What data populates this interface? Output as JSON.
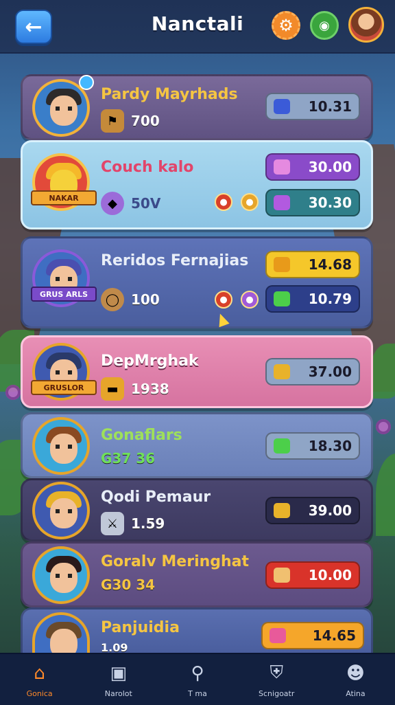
{
  "header": {
    "title": "Nanctali"
  },
  "cards": [
    {
      "name": "Pardy Mayrhads",
      "stat": "700",
      "banner": "",
      "price": "10.31"
    },
    {
      "name": "Couch kalo",
      "stat": "50V",
      "banner": "NAKAR",
      "price_top": "30.00",
      "price_bottom": "30.30"
    },
    {
      "name": "Reridos Fernajias",
      "stat": "100",
      "banner": "GRUS ARLS",
      "price_top": "14.68",
      "price_bottom": "10.79"
    },
    {
      "name": "DepMrghak",
      "stat": "1938",
      "banner": "GRUSLOR",
      "price": "37.00"
    },
    {
      "name": "Gonaflars",
      "stat": "G37 36",
      "price": "18.30"
    },
    {
      "name": "Qodi Pemaur",
      "stat": "1.59",
      "price": "39.00"
    },
    {
      "name": "Goralv Meringhat",
      "stat": "G30 34",
      "price": "10.00"
    },
    {
      "name": "Panjuidia",
      "stat": "1.09",
      "price": "14.65"
    }
  ],
  "nav": [
    {
      "label": "Gonica",
      "icon": "home-icon"
    },
    {
      "label": "Narolot",
      "icon": "bag-icon"
    },
    {
      "label": "T ma",
      "icon": "search-icon"
    },
    {
      "label": "Scnigoatr",
      "icon": "shield-icon"
    },
    {
      "label": "Atina",
      "icon": "profile-icon"
    }
  ],
  "colors": {
    "accent": "#ff8a2a",
    "topbar": "#1f3256",
    "nav": "#12203f"
  }
}
